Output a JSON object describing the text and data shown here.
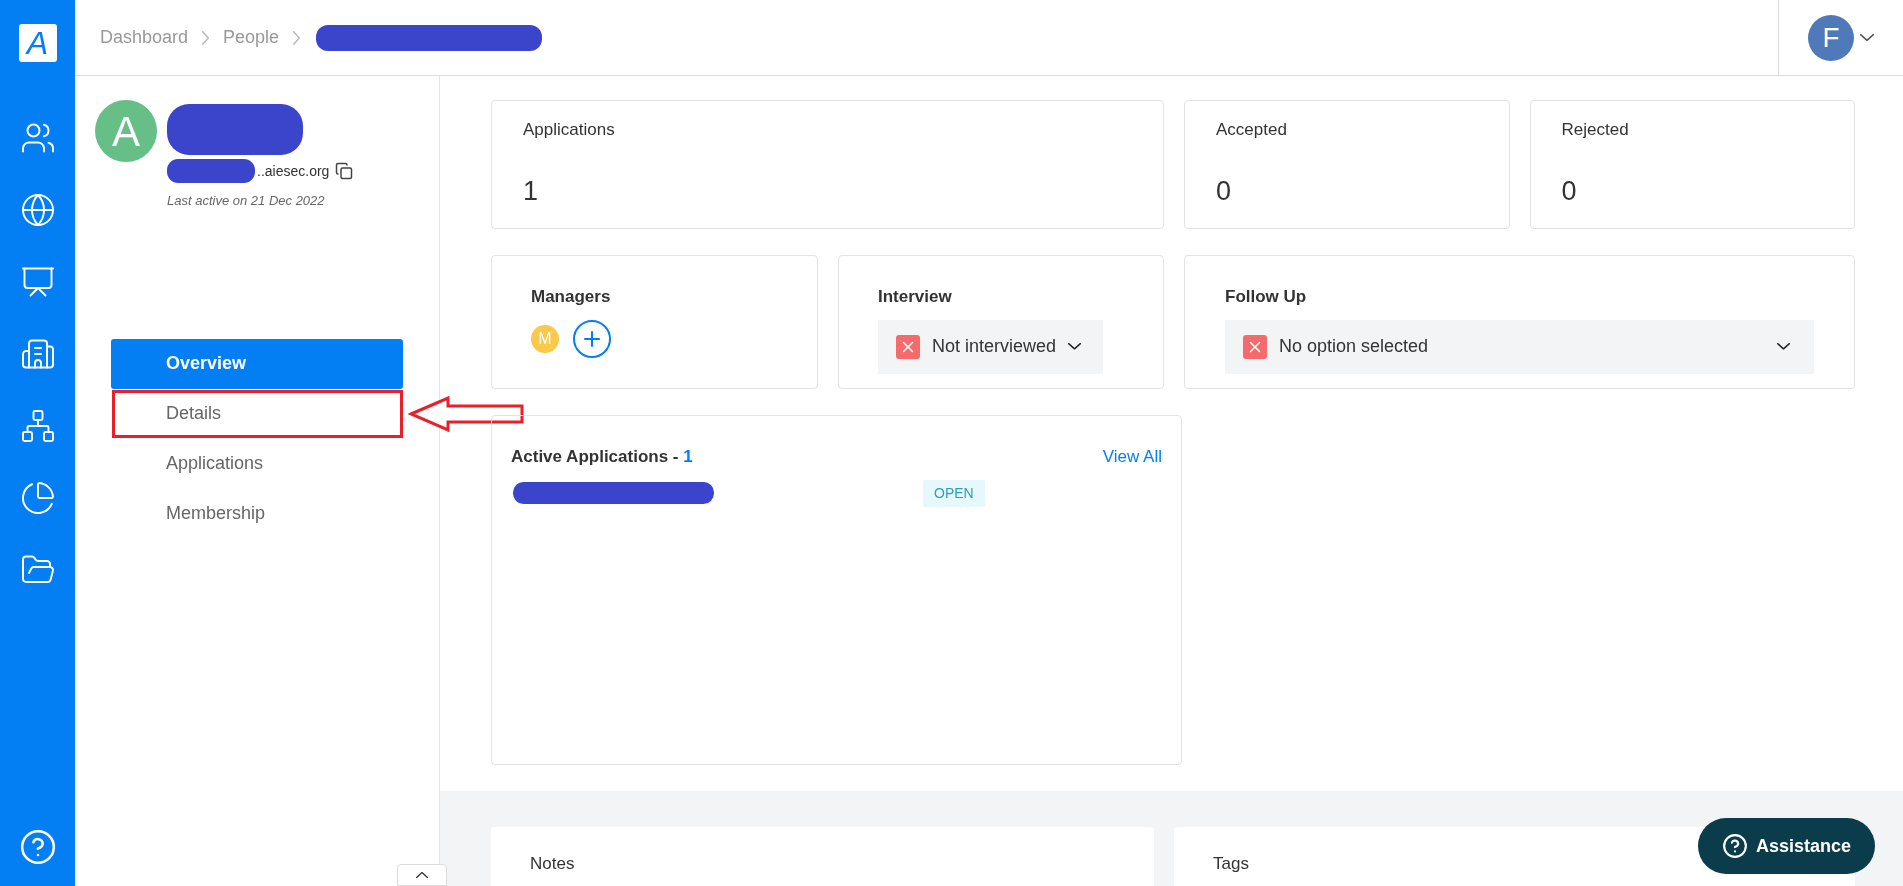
{
  "logo": "A",
  "breadcrumb": [
    "Dashboard",
    "People"
  ],
  "user_avatar": "F",
  "profile": {
    "avatar": "A",
    "email": "..aiesec.org",
    "last_active": "Last active on 21 Dec 2022"
  },
  "menu": [
    {
      "label": "Overview",
      "selected": true
    },
    {
      "label": "Details",
      "selected": false,
      "highlighted": true
    },
    {
      "label": "Applications",
      "selected": false
    },
    {
      "label": "Membership",
      "selected": false
    }
  ],
  "stats": [
    {
      "label": "Applications",
      "value": "1"
    },
    {
      "label": "Accepted",
      "value": "0"
    },
    {
      "label": "Rejected",
      "value": "0"
    }
  ],
  "managers": {
    "title": "Managers",
    "avatar": "M"
  },
  "interview": {
    "title": "Interview",
    "value": "Not interviewed"
  },
  "follow_up": {
    "title": "Follow Up",
    "value": "No option selected"
  },
  "active_applications": {
    "title": "Active Applications - ",
    "count": "1",
    "link": "View All",
    "status": "OPEN"
  },
  "bottom_cards": [
    "Notes",
    "Tags"
  ],
  "assistance": "Assistance"
}
